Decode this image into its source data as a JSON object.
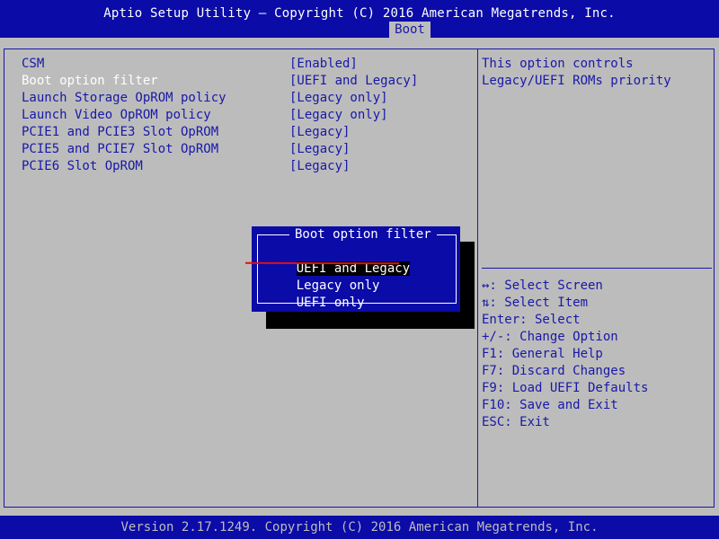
{
  "header": {
    "title": "Aptio Setup Utility – Copyright (C) 2016 American Megatrends, Inc.",
    "tabs": [
      {
        "label": "Boot",
        "active": true
      }
    ]
  },
  "settings": [
    {
      "label": "CSM",
      "value": "[Enabled]",
      "selected": false
    },
    {
      "label": "Boot option filter",
      "value": "[UEFI and Legacy]",
      "selected": true
    },
    {
      "label": "Launch Storage OpROM policy",
      "value": "[Legacy only]",
      "selected": false
    },
    {
      "label": "Launch Video OpROM policy",
      "value": "[Legacy only]",
      "selected": false
    },
    {
      "label": "PCIE1 and PCIE3 Slot OpROM",
      "value": "[Legacy]",
      "selected": false
    },
    {
      "label": "PCIE5 and PCIE7 Slot OpROM",
      "value": "[Legacy]",
      "selected": false
    },
    {
      "label": "PCIE6 Slot OpROM",
      "value": "[Legacy]",
      "selected": false
    }
  ],
  "help": {
    "lines": [
      "This option controls",
      "Legacy/UEFI ROMs priority"
    ],
    "keys": [
      "↔: Select Screen",
      "⇅: Select Item",
      "Enter: Select",
      "+/-: Change Option",
      "F1: General Help",
      "F7: Discard Changes",
      "F9: Load UEFI Defaults",
      "F10: Save and Exit",
      "ESC: Exit"
    ]
  },
  "popup": {
    "title": "Boot option filter",
    "options": [
      {
        "label": "UEFI and Legacy",
        "highlighted": true
      },
      {
        "label": "Legacy only",
        "highlighted": false
      },
      {
        "label": "UEFI only",
        "highlighted": false
      }
    ]
  },
  "footer": {
    "text": "Version 2.17.1249. Copyright (C) 2016 American Megatrends, Inc."
  },
  "colors": {
    "bar_blue": "#0b0ba8",
    "panel_gray": "#bcbcbc",
    "text_blue": "#1818a8",
    "annotation_red": "#e01010"
  }
}
